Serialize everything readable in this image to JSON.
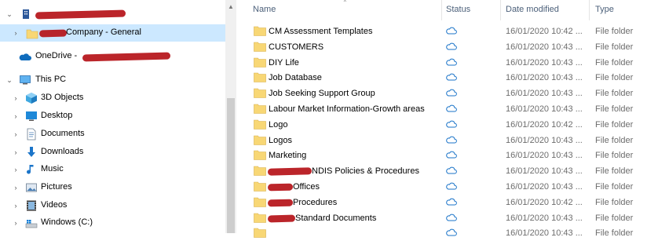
{
  "nav": {
    "items": [
      {
        "label": "Company - General",
        "icon": "folder-icon",
        "expanded": false,
        "selected": true
      },
      {
        "label": "OneDrive - ",
        "icon": "onedrive-cloud-icon"
      },
      {
        "label": "This PC",
        "icon": "pc-icon",
        "expanded": true
      },
      {
        "label": "3D Objects",
        "icon": "3d-objects-icon"
      },
      {
        "label": "Desktop",
        "icon": "desktop-icon"
      },
      {
        "label": "Documents",
        "icon": "documents-icon"
      },
      {
        "label": "Downloads",
        "icon": "downloads-icon"
      },
      {
        "label": "Music",
        "icon": "music-icon"
      },
      {
        "label": "Pictures",
        "icon": "pictures-icon"
      },
      {
        "label": "Videos",
        "icon": "videos-icon"
      },
      {
        "label": "Windows  (C:)",
        "icon": "drive-icon"
      }
    ]
  },
  "columns": {
    "name": "Name",
    "status": "Status",
    "date": "Date modified",
    "type": "Type"
  },
  "files": [
    {
      "name": "CM Assessment Templates",
      "date": "16/01/2020 10:42 ...",
      "type": "File folder"
    },
    {
      "name": "CUSTOMERS",
      "date": "16/01/2020 10:43 ...",
      "type": "File folder"
    },
    {
      "name": "DIY Life",
      "date": "16/01/2020 10:43 ...",
      "type": "File folder"
    },
    {
      "name": "Job Database",
      "date": "16/01/2020 10:43 ...",
      "type": "File folder"
    },
    {
      "name": "Job Seeking Support Group",
      "date": "16/01/2020 10:43 ...",
      "type": "File folder"
    },
    {
      "name": "Labour Market Information-Growth areas",
      "date": "16/01/2020 10:43 ...",
      "type": "File folder"
    },
    {
      "name": "Logo",
      "date": "16/01/2020 10:42 ...",
      "type": "File folder"
    },
    {
      "name": "Logos",
      "date": "16/01/2020 10:43 ...",
      "type": "File folder"
    },
    {
      "name": "Marketing",
      "date": "16/01/2020 10:43 ...",
      "type": "File folder"
    },
    {
      "name": "NDIS Policies & Procedures",
      "date": "16/01/2020 10:43 ...",
      "type": "File folder"
    },
    {
      "name": "Offices",
      "date": "16/01/2020 10:43 ...",
      "type": "File folder"
    },
    {
      "name": "Procedures",
      "date": "16/01/2020 10:42 ...",
      "type": "File folder"
    },
    {
      "name": "Standard Documents",
      "date": "16/01/2020 10:43 ...",
      "type": "File folder"
    },
    {
      "name": "",
      "date": "16/01/2020 10:43 ...",
      "type": "File folder"
    }
  ]
}
